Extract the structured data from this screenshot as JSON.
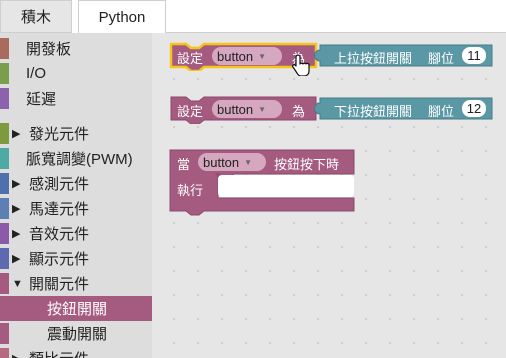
{
  "tabs": {
    "blocks": "積木",
    "python": "Python"
  },
  "toolbox": {
    "categories": [
      {
        "label": "開發板",
        "color": "#a96b5c",
        "arrow": ""
      },
      {
        "label": "I/O",
        "color": "#7a9e4d",
        "arrow": ""
      },
      {
        "label": "延遲",
        "color": "#8c62ad",
        "arrow": ""
      },
      {
        "label": "發光元件",
        "color": "#7d9a3e",
        "arrow": "▶"
      },
      {
        "label": "脈寬調變(PWM)",
        "color": "#4faaa4",
        "arrow": ""
      },
      {
        "label": "感測元件",
        "color": "#4f6fad",
        "arrow": "▶"
      },
      {
        "label": "馬達元件",
        "color": "#5d7fb4",
        "arrow": "▶"
      },
      {
        "label": "音效元件",
        "color": "#8b5aa8",
        "arrow": "▶"
      },
      {
        "label": "顯示元件",
        "color": "#5e6ab0",
        "arrow": "▶"
      },
      {
        "label": "開關元件",
        "color": "#a55b80",
        "arrow": "▼"
      },
      {
        "label": "按鈕開關",
        "color": "#a55b80",
        "arrow": "",
        "selected": true
      },
      {
        "label": "震動開關",
        "color": "#a55b80",
        "arrow": ""
      },
      {
        "label": "類比元件",
        "color": "#b56a82",
        "arrow": "▶"
      }
    ]
  },
  "workspace": {
    "block1": {
      "set_label": "設定",
      "variable": "button",
      "to_label": "為",
      "value_block": {
        "label": "上拉按鈕開關",
        "pin_label": "腳位",
        "pin": "11"
      }
    },
    "block2": {
      "set_label": "設定",
      "variable": "button",
      "to_label": "為",
      "value_block": {
        "label": "下拉按鈕開關",
        "pin_label": "腳位",
        "pin": "12"
      }
    },
    "block3": {
      "when_label": "當",
      "variable": "button",
      "event_label": "按鈕按下時",
      "do_label": "執行"
    }
  },
  "colors": {
    "switch_block": "#a55b80",
    "value_block": "#5b98a5",
    "selected_outline": "#f5c518",
    "workspace_bg": "#e6e6e6"
  }
}
